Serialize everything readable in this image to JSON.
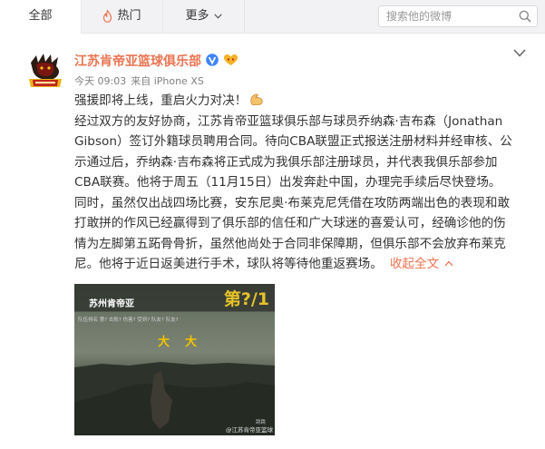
{
  "topbar": {
    "tabs": [
      {
        "label": "全部",
        "active": true
      },
      {
        "label": "热门",
        "icon": "flame-icon"
      },
      {
        "label": "更多",
        "icon": "caret-down-icon"
      }
    ],
    "search_placeholder": "搜索他的微博"
  },
  "post": {
    "author": "江苏肯帝亚篮球俱乐部",
    "time": "今天 09:03",
    "source": "来自 iPhone XS",
    "lines": [
      "强援即将上线，重启火力对决！",
      "经过双方的友好协商，江苏肯帝亚篮球俱乐部与球员乔纳森·吉布森（Jonathan",
      "Gibson）签订外籍球员聘用合同。待向CBA联盟正式报送注册材料并经审核、公",
      "示通过后，乔纳森·吉布森将正式成为我俱乐部注册球员，并代表我俱乐部参加",
      "CBA联赛。他将于周五（11月15日）出发奔赴中国，办理完手续后尽快登场。",
      "同时，虽然仅出战四场比赛，安东尼奥·布莱克尼凭借在攻防两端出色的表现和敢",
      "打敢拼的作风已经赢得到了俱乐部的信任和广大球迷的喜爱认可，经确诊他的伤",
      "情为左脚第五跖骨骨折，虽然他尚处于合同非保障期，但俱乐部不会放弃布莱克",
      "尼。他将于近日返美进行手术，球队将等待他重返赛场。"
    ],
    "collapse_label": "收起全文",
    "image": {
      "title": "苏州肯帝亚",
      "big_text": "第?/1",
      "row_text": "队伍排名 第?  击败?  伤害?  受到?  队友?  队友?",
      "da_left": "大",
      "da_right": "大",
      "watermark": "@江苏肯帝亚篮球",
      "mark": "跳跳"
    }
  },
  "colors": {
    "accent": "#eb7350",
    "verified": "#3d84ff",
    "topbar_bg": "#f2f2f5"
  }
}
